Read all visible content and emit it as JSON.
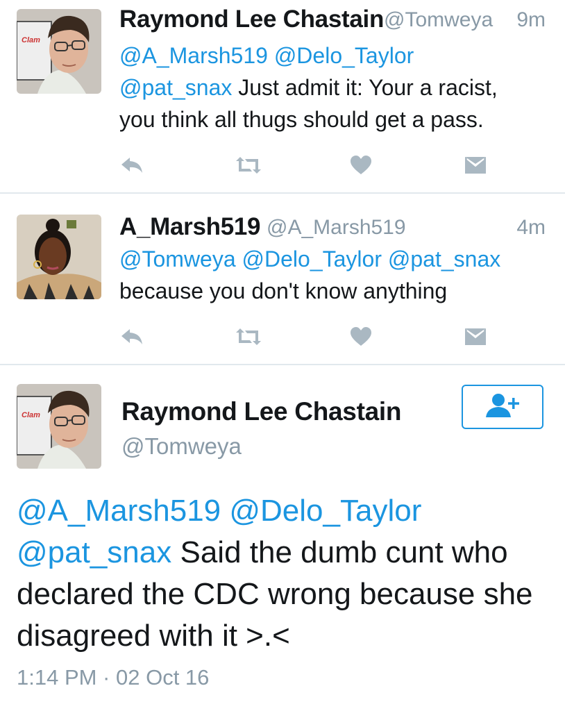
{
  "colors": {
    "link": "#1b95e0",
    "muted": "#8899a6",
    "text": "#14171a",
    "divider": "#e1e8ed"
  },
  "tweets": [
    {
      "name": "Raymond Lee Chastain",
      "handle": "@Tomweya",
      "time": "9m",
      "lines": [
        [
          {
            "t": "@A_Marsh519 @Delo_Taylor",
            "m": true
          }
        ],
        [
          {
            "t": "@pat_snax",
            "m": true
          },
          {
            "t": " Just admit it: Your a racist,",
            "m": false
          }
        ],
        [
          {
            "t": "you think all thugs should get a pass.",
            "m": false
          }
        ]
      ],
      "avatar_label": "Clam",
      "actions": [
        "reply-icon",
        "retweet-icon",
        "like-icon",
        "direct-message-icon"
      ]
    },
    {
      "name": "A_Marsh519",
      "handle": "@A_Marsh519",
      "time": "4m",
      "lines": [
        [
          {
            "t": "@Tomweya @Delo_Taylor @pat_snax",
            "m": true
          }
        ],
        [
          {
            "t": "because you don't know anything",
            "m": false
          }
        ]
      ],
      "actions": [
        "reply-icon",
        "retweet-icon",
        "like-icon",
        "direct-message-icon"
      ]
    }
  ],
  "detail": {
    "name": "Raymond Lee Chastain",
    "handle": "@Tomweya",
    "avatar_label": "Clam",
    "follow_icon": "follow-user-icon",
    "lines": [
      [
        {
          "t": "@A_Marsh519 @Delo_Taylor",
          "m": true
        }
      ],
      [
        {
          "t": "@pat_snax",
          "m": true
        },
        {
          "t": " Said the dumb cunt who",
          "m": false
        }
      ],
      [
        {
          "t": "declared the CDC wrong because she",
          "m": false
        }
      ],
      [
        {
          "t": "disagreed with it >.<",
          "m": false
        }
      ]
    ],
    "timestamp": "1:14 PM · 02 Oct 16"
  }
}
